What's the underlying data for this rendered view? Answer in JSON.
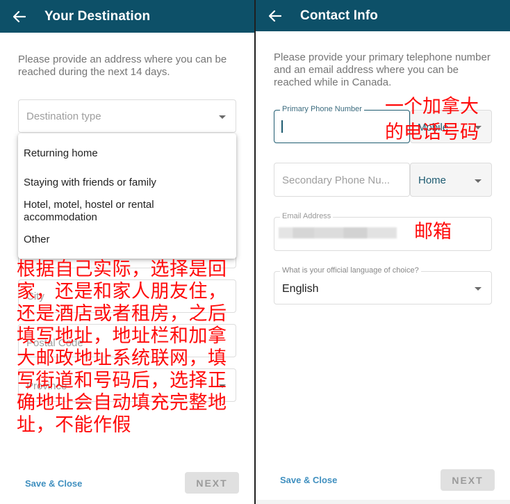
{
  "left": {
    "header": {
      "title": "Your Destination",
      "back_icon": "arrow-left-icon"
    },
    "intro": "Please provide an address where you can be reached during the next 14 days.",
    "destination_type": {
      "placeholder": "Destination type"
    },
    "menu_options": [
      "Returning home",
      "Staying with friends or family",
      "Hotel, motel, hostel or rental accommodation",
      "Other"
    ],
    "fields": {
      "city": "City",
      "postal_code": "Postal Code",
      "province": "Province"
    },
    "footer": {
      "save_close": "Save & Close",
      "next": "NEXT"
    },
    "annotation": "根据自己实际，选择是回家，还是和家人朋友住，还是酒店或者租房，之后填写地址，地址栏和加拿大邮政地址系统联网，填写街道和号码后，选择正确地址会自动填充完整地址，不能作假"
  },
  "right": {
    "header": {
      "title": "Contact Info",
      "back_icon": "arrow-left-icon"
    },
    "intro": "Please provide your primary telephone number and an email address where you can be reached while in Canada.",
    "primary_phone": {
      "label": "Primary Phone Number",
      "value": "",
      "type": "Mobile"
    },
    "secondary_phone": {
      "placeholder": "Secondary Phone Nu...",
      "type": "Home"
    },
    "email": {
      "label": "Email Address",
      "value": "[redacted]"
    },
    "language": {
      "label": "What is your official language of choice?",
      "value": "English"
    },
    "footer": {
      "save_close": "Save & Close",
      "next": "NEXT"
    },
    "annotations": {
      "phone_line1": "一个加拿大",
      "phone_line2": "的电话号码",
      "email": "邮箱"
    }
  },
  "colors": {
    "app_bar": "#0d5068",
    "accent_link": "#3f8fbf",
    "annotation_red": "#ff0a0a",
    "focus_border": "#1e5b70"
  }
}
